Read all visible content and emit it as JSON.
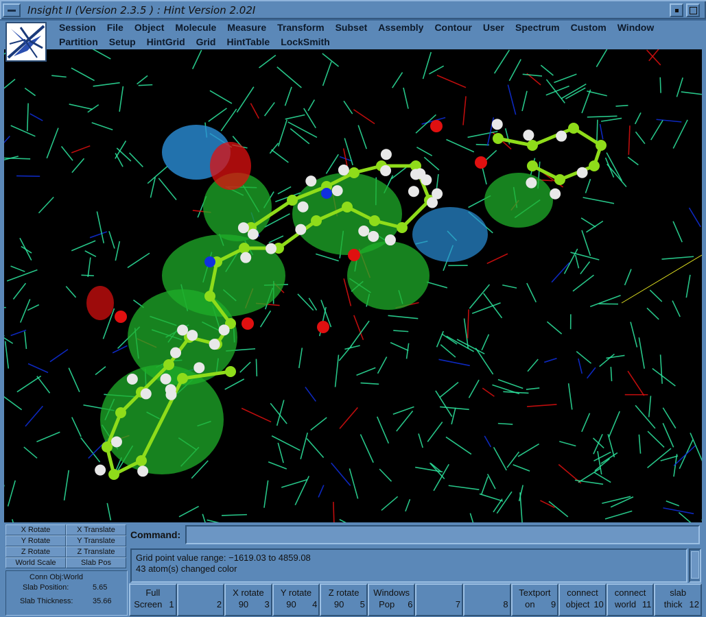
{
  "window": {
    "title": "Insight II (Version 2.3.5 ) : Hint  Version 2.02I"
  },
  "menu": {
    "row1": [
      "Session",
      "File",
      "Object",
      "Molecule",
      "Measure",
      "Transform",
      "Subset",
      "Assembly",
      "Contour",
      "User",
      "Spectrum",
      "Custom",
      "Window"
    ],
    "row2": [
      "Partition",
      "Setup",
      "HintGrid",
      "Grid",
      "HintTable",
      "LockSmith"
    ]
  },
  "controls": {
    "buttons": [
      "X Rotate",
      "X Translate",
      "Y Rotate",
      "Y Translate",
      "Z Rotate",
      "Z Translate",
      "World Scale",
      "Slab Pos"
    ]
  },
  "info": {
    "conn_obj": "Conn Obj:World",
    "slab_position_label": "Slab Position:",
    "slab_position_value": "5.65",
    "slab_thickness_label": "Slab Thickness:",
    "slab_thickness_value": "35.66"
  },
  "command": {
    "label": "Command:",
    "value": ""
  },
  "output": {
    "lines": [
      "Grid point value range: −1619.03 to 4859.08",
      "43 atom(s) changed color"
    ]
  },
  "function_keys": [
    {
      "line1": "Full",
      "line2": "Screen",
      "num": "1"
    },
    {
      "line1": "",
      "line2": "",
      "num": "2"
    },
    {
      "line1": "X rotate",
      "line2": "90",
      "num": "3"
    },
    {
      "line1": "Y rotate",
      "line2": "90",
      "num": "4"
    },
    {
      "line1": "Z rotate",
      "line2": "90",
      "num": "5"
    },
    {
      "line1": "Windows",
      "line2": "Pop",
      "num": "6"
    },
    {
      "line1": "",
      "line2": "",
      "num": "7"
    },
    {
      "line1": "",
      "line2": "",
      "num": "8"
    },
    {
      "line1": "Textport",
      "line2": "on",
      "num": "9"
    },
    {
      "line1": "connect",
      "line2": "object",
      "num": "10"
    },
    {
      "line1": "connect",
      "line2": "world",
      "num": "11"
    },
    {
      "line1": "slab",
      "line2": "thick",
      "num": "12"
    }
  ],
  "colors": {
    "panel": "#5b88b8",
    "viewport": "#000000",
    "protein_wire": "#2ee8a0",
    "ligand": "#8fdc1a",
    "hydrophobic_surface": "#1fae2a",
    "polar_surface": "#2a8fd8",
    "oxygen": "#e01010",
    "nitrogen": "#1030e0",
    "hydrogen": "#e8e8e8"
  }
}
